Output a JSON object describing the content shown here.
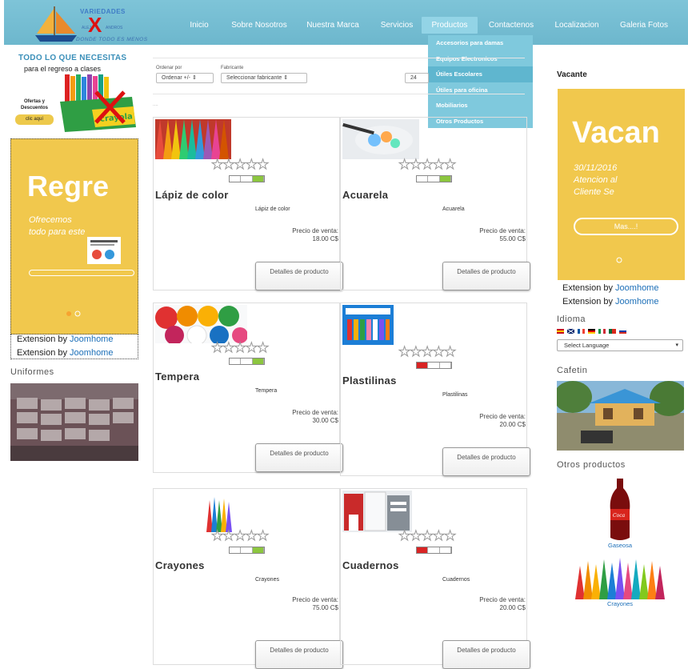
{
  "logo": {
    "name": "VARIEDADES",
    "line2a": "ALEJ",
    "line2b": "ANDROS",
    "slogan": "DONDE TODO ES MENOS"
  },
  "nav": {
    "items": [
      "Inicio",
      "Sobre Nosotros",
      "Nuestra Marca",
      "Servicios",
      "Productos",
      "Contactenos",
      "Localizacion",
      "Galeria Fotos"
    ],
    "dropdown": [
      "Accesorios para damas",
      "Equipos Electronicos",
      "Útiles Escolares",
      "Útiles para oficina",
      "Mobiliarios",
      "Otros Productos"
    ]
  },
  "left": {
    "promo_heading": "TODO LO QUE NECESITAS",
    "promo_sub": "para el regreso a clases",
    "promo_offers": "Ofertas y Descuentos",
    "promo_button": "clic aquí",
    "slider_title": "Regre",
    "slider_text": "Ofrecemos todo para este",
    "ext1_prefix": "Extension by",
    "ext1_link": "Joomhome",
    "ext2_prefix": "Extension by",
    "ext2_link": "Joomhome",
    "uniformes": "Uniformes"
  },
  "toolbar": {
    "order_label": "Ordenar por",
    "order_value": "Ordenar +/- ",
    "maker_label": "Fabricante",
    "maker_value": "Seleccionar fabricante",
    "per_page": "24"
  },
  "products": [
    {
      "name": "Lápiz de color",
      "desc": "Lápiz de color",
      "price_label": "Precio de venta:",
      "price": "18.00 C$",
      "button": "Detalles de producto",
      "rating_color": "#8cc63f"
    },
    {
      "name": "Acuarela",
      "desc": "Acuarela",
      "price_label": "Precio de venta:",
      "price": "55.00 C$",
      "button": "Detalles de producto",
      "rating_color": "#8cc63f"
    },
    {
      "name": "Tempera",
      "desc": "Tempera",
      "price_label": "Precio de venta:",
      "price": "30.00 C$",
      "button": "Detalles de producto",
      "rating_color": "#8cc63f"
    },
    {
      "name": "Plastilinas",
      "desc": "Plastilinas",
      "price_label": "Precio de venta:",
      "price": "20.00 C$",
      "button": "Detalles de producto",
      "rating_color": "#d92424"
    },
    {
      "name": "Crayones",
      "desc": "Crayones",
      "price_label": "Precio de venta:",
      "price": "75.00 C$",
      "button": "Detalles de producto",
      "rating_color": "#8cc63f"
    },
    {
      "name": "Cuadernos",
      "desc": "Cuadernos",
      "price_label": "Precio de venta:",
      "price": "20.00 C$",
      "button": "Detalles de producto",
      "rating_color": "#d92424"
    }
  ],
  "right": {
    "vacante_heading": "Vacante",
    "slider_title": "Vacan",
    "slider_date": "30/11/2016",
    "slider_text": "Atencion al Cliente Se",
    "slider_button": "Mas....!",
    "ext1_prefix": "Extension by",
    "ext1_link": "Joomhome",
    "ext2_prefix": "Extension by",
    "ext2_link": "Joomhome",
    "idioma": "Idioma",
    "language_select": "Select Language",
    "cafetin": "Cafetin",
    "otros": "Otros productos",
    "prod1": "Gaseosa",
    "prod2": "Crayones"
  }
}
